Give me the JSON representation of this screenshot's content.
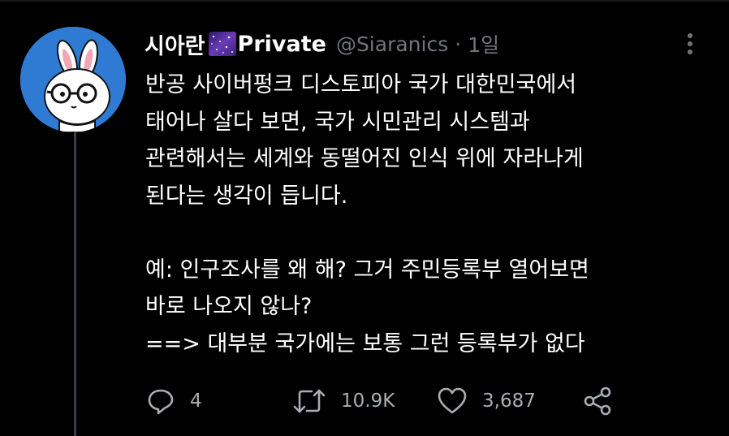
{
  "tweet": {
    "display_name_before_badge": "시아란",
    "badge_icon": "galaxy-emoji",
    "display_name_after_badge": "Private",
    "handle": "@Siaranics",
    "separator": "·",
    "time": "1일",
    "body_lines": [
      "반공 사이버펑크 디스토피아 국가 대한민국에서",
      "태어나 살다 보면, 국가 시민관리 시스템과",
      "관련해서는 세계와 동떨어진 인식 위에 자라나게",
      "된다는 생각이 듭니다.",
      "",
      "예: 인구조사를 왜 해? 그거 주민등록부 열어보면",
      "바로 나오지 않나?",
      "==> 대부분 국가에는 보통 그런 등록부가 없다"
    ],
    "actions": {
      "reply": {
        "icon": "reply-icon",
        "count": "4"
      },
      "retweet": {
        "icon": "retweet-icon",
        "count": "10.9K"
      },
      "like": {
        "icon": "heart-icon",
        "count": "3,687"
      },
      "share": {
        "icon": "share-icon"
      }
    }
  },
  "colors": {
    "background": "#000000",
    "text": "#ffffff",
    "muted": "#71767b",
    "avatar_bg": "#2f7bd4",
    "thread_line": "#3a3f44"
  }
}
